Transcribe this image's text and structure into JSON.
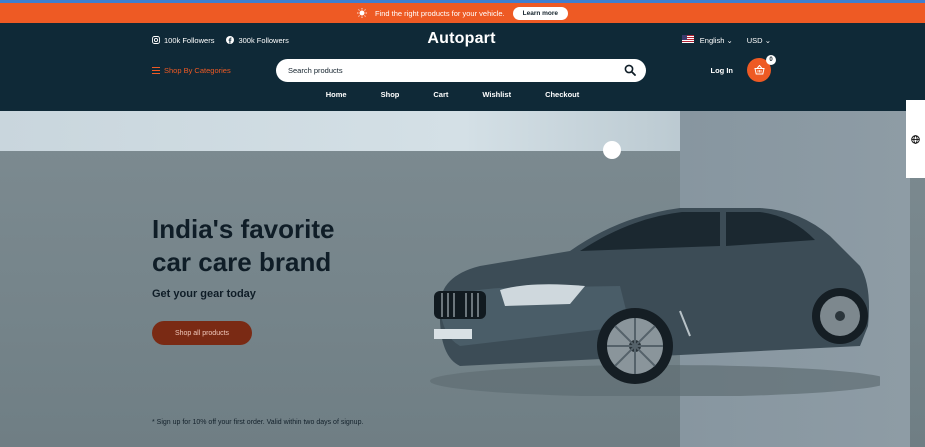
{
  "announcement": {
    "text": "Find the right products for your vehicle.",
    "button_label": "Learn more",
    "icon": "bulb-icon"
  },
  "header": {
    "social": [
      {
        "icon": "instagram-icon",
        "label": "100k Followers"
      },
      {
        "icon": "facebook-icon",
        "label": "300k Followers"
      }
    ],
    "logo": "Autopart",
    "language": "English",
    "currency": "USD",
    "categories_label": "Shop By Categories",
    "search_placeholder": "Search products",
    "login_label": "Log In",
    "cart_count": "0"
  },
  "nav": [
    "Home",
    "Shop",
    "Cart",
    "Wishlist",
    "Checkout"
  ],
  "hero": {
    "headline_line1": "India's favorite",
    "headline_line2": "car care brand",
    "subheadline": "Get your gear today",
    "cta_label": "Shop all products",
    "footnote": "* Sign up for 10% off your first order. Valid within two days of signup."
  },
  "colors": {
    "accent": "#ee5a24",
    "header_bg": "#0f2937",
    "cta_bg": "#7a2a14"
  }
}
